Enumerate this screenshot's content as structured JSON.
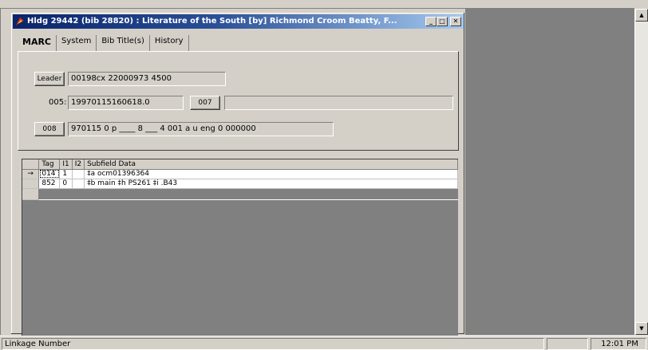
{
  "window": {
    "title": "Hldg 29442 (bib 28820) : Literature of the South [by] Richmond Croom Beatty, F...",
    "minimize_label": "_",
    "maximize_label": "□",
    "close_label": "✕"
  },
  "tabs": [
    {
      "label": "MARC",
      "active": true
    },
    {
      "label": "System",
      "active": false
    },
    {
      "label": "Bib Title(s)",
      "active": false
    },
    {
      "label": "History",
      "active": false
    }
  ],
  "marc": {
    "leader_button": "Leader",
    "leader_value": "00198cx  22000973 4500",
    "f005_label": "005:",
    "f005_value": "19970115160618.0",
    "f007_button": "007",
    "f007_value": "",
    "f008_button": "008",
    "f008_value": "970115 0 p ____ 8 ___ 4 001 a u eng 0 000000"
  },
  "grid": {
    "columns": [
      "Tag",
      "I1",
      "I2",
      "Subfield Data"
    ],
    "rows": [
      {
        "marker": "→",
        "tag": "014",
        "i1": "1",
        "i2": "",
        "data": "‡a ocm01396364"
      },
      {
        "marker": "",
        "tag": "852",
        "i1": "0",
        "i2": "",
        "data": "‡b main ‡h PS261 ‡i .B43"
      },
      {
        "marker": "",
        "tag": "",
        "i1": "",
        "i2": "",
        "data": ""
      }
    ]
  },
  "status": {
    "message": "Linkage Number",
    "time": "12:01 PM"
  },
  "colors": {
    "titlebar_start": "#0a246a",
    "titlebar_end": "#a6caf0",
    "face": "#d4d0c8",
    "mdi_background": "#808080"
  }
}
